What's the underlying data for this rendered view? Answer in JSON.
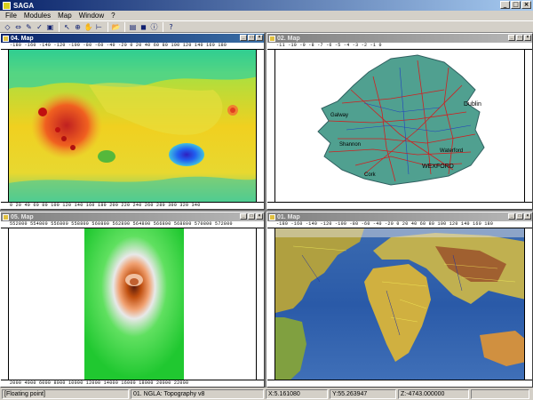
{
  "app": {
    "title": "SAGA"
  },
  "window_controls": {
    "minimize": "_",
    "maximize": "□",
    "close": "×"
  },
  "menu": [
    "File",
    "Modules",
    "Map",
    "Window",
    "?"
  ],
  "toolbar": {
    "icons": [
      "open-icon",
      "open-module-icon",
      "save-icon",
      "new-map-icon",
      "window-icon",
      "pointer-icon",
      "zoom-icon",
      "pan-icon",
      "measure-icon",
      "open-file-icon",
      "workspace-icon",
      "data-icon",
      "info-icon",
      "help-icon"
    ],
    "glyphs": [
      "◇",
      "⇔",
      "✎",
      "✓",
      "▣",
      "↖",
      "⊕",
      "✋",
      "⊢",
      "📂",
      "▤",
      "◼",
      "ⓘ",
      "?"
    ]
  },
  "windows": [
    {
      "id": "map-04",
      "title": "04. Map",
      "active": true,
      "ruler_top": "-180 -160 -140 -120 -100 -80 -60 -40 -20 0 20 40 60 80 100 120 140 160 180",
      "ruler_bottom": "0 20 40 60 80 100 120 140 160 180 200 220 240 260 280 300 320 340"
    },
    {
      "id": "map-02",
      "title": "02. Map",
      "active": false,
      "ruler_top": "-11 -10 -9 -8 -7 -6 -5 -4 -3 -2 -1 0",
      "ruler_bottom": "",
      "labels": [
        "Dublin",
        "WEXFORD",
        "Shannon",
        "Waterford",
        "Cork",
        "Galway"
      ]
    },
    {
      "id": "map-05",
      "title": "05. Map",
      "active": false,
      "ruler_top": "552800 554800 556800 558800 560800 562800 564800 566800 568800 570800 572800",
      "ruler_bottom": "2000 4000 6000 8000 10000 12000 14000 16000 18000 20000 22000"
    },
    {
      "id": "map-01",
      "title": "01. Map",
      "active": false,
      "ruler_top": "-180 -160 -140 -120 -100 -80 -60 -40 -20 0 20 40 60 80 100 120 140 160 180",
      "ruler_bottom": ""
    }
  ],
  "status": {
    "cells": [
      "[Floating point]",
      "01. NGLA: Topography v8",
      "X:5.161080",
      "Y:55.263947",
      "Z:-4743.000000"
    ]
  },
  "colors": {
    "active_title": "#0a246a",
    "inactive_title": "#808080",
    "chrome": "#d4d0c8"
  }
}
